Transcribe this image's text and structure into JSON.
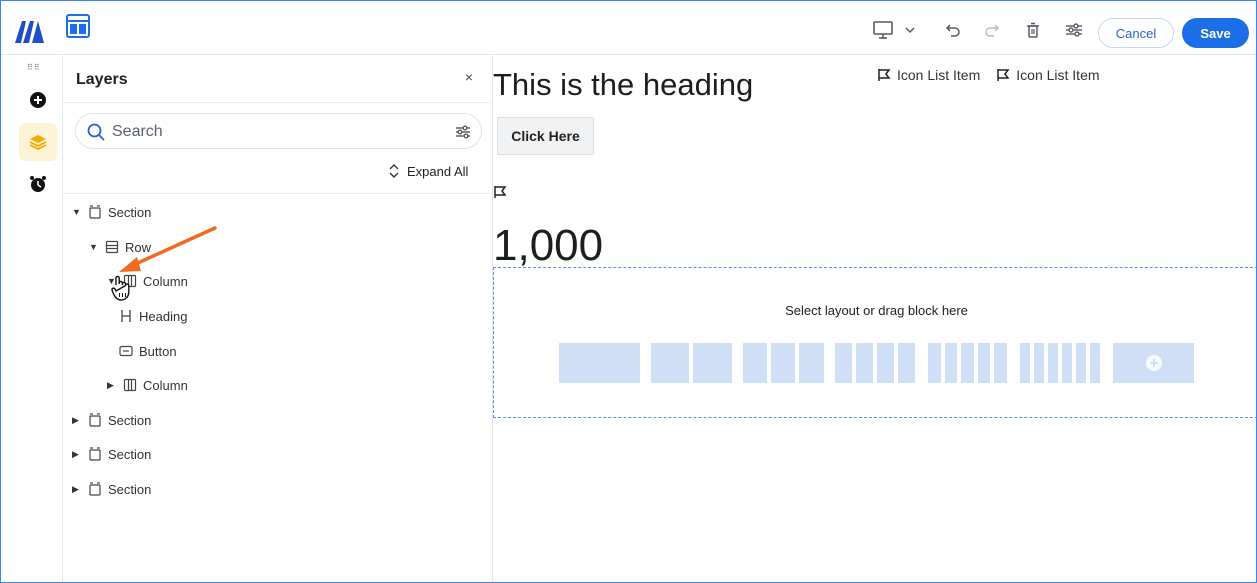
{
  "header": {
    "cancel_label": "Cancel",
    "save_label": "Save"
  },
  "layers_panel": {
    "title": "Layers",
    "close_glyph": "×",
    "search_placeholder": "Search",
    "expand_all_label": "Expand All",
    "tree": [
      {
        "label": "Section",
        "icon": "section-icon",
        "caret": "▼"
      },
      {
        "label": "Row",
        "icon": "row-icon",
        "caret": "▼"
      },
      {
        "label": "Column",
        "icon": "column-icon",
        "caret": "▼"
      },
      {
        "label": "Heading",
        "icon": "heading-icon",
        "caret": ""
      },
      {
        "label": "Button",
        "icon": "button-icon",
        "caret": ""
      },
      {
        "label": "Column",
        "icon": "column-icon",
        "caret": "▶"
      },
      {
        "label": "Section",
        "icon": "section-icon",
        "caret": "▶"
      },
      {
        "label": "Section",
        "icon": "section-icon",
        "caret": "▶"
      },
      {
        "label": "Section",
        "icon": "section-icon",
        "caret": "▶"
      }
    ]
  },
  "canvas": {
    "heading": "This is the heading",
    "button_label": "Click Here",
    "icon_list": [
      "Icon List Item",
      "Icon List Item"
    ],
    "counter": "1,000",
    "dropzone_label": "Select layout or drag block here"
  },
  "colors": {
    "accent": "#1c6ee8",
    "layout_option": "#cfe0f6",
    "active_rail": "#fdf3d6",
    "annotation_arrow": "#f26a22"
  }
}
